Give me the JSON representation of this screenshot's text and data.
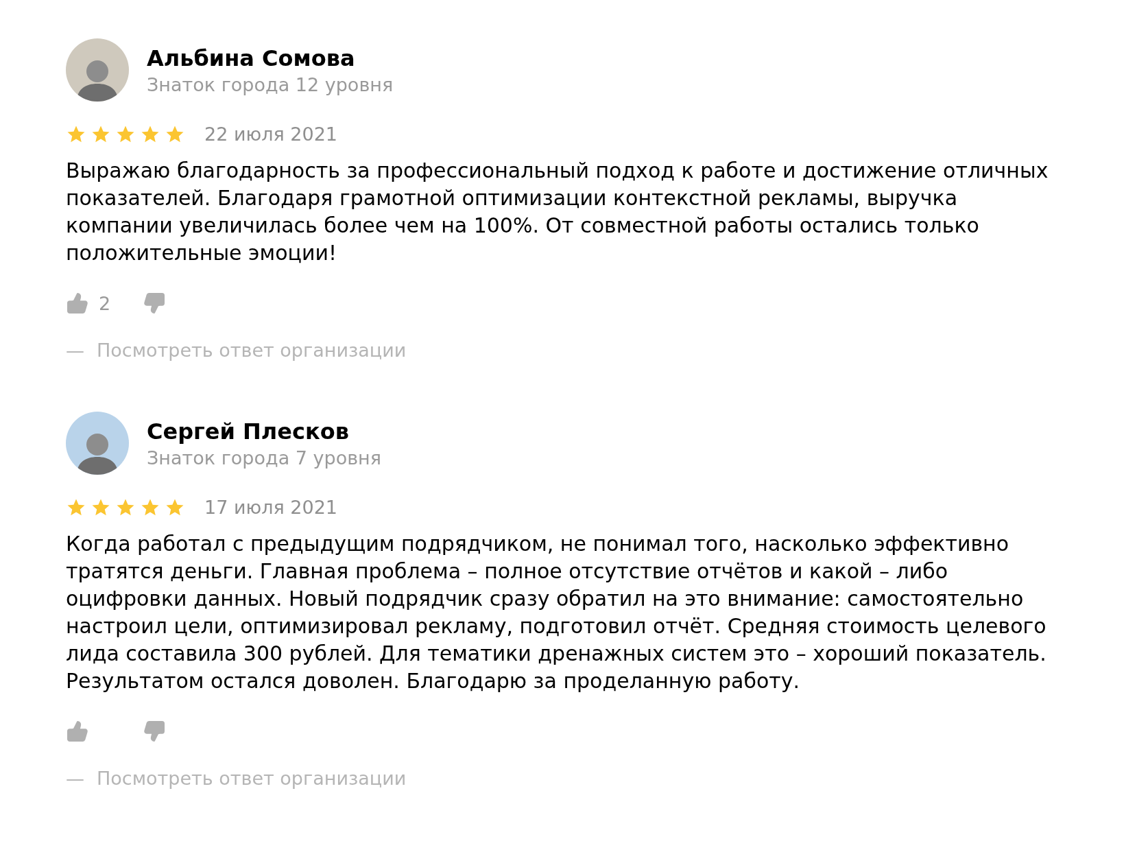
{
  "reviews": [
    {
      "name": "Альбина Сомова",
      "level": "Знаток города 12 уровня",
      "stars": 5,
      "date": "22 июля 2021",
      "text": "Выражаю благодарность за профессиональный подход к работе и достижение отличных показателей. Благодаря грамотной оптимизации контекстной рекламы, выручка компании увеличилась более чем на 100%. От совместной работы остались только положительные эмоции!",
      "likes": "2",
      "dash": "—",
      "reply_link": "Посмотреть ответ организации"
    },
    {
      "name": "Сергей Плесков",
      "level": "Знаток города 7 уровня",
      "stars": 5,
      "date": "17 июля 2021",
      "text": "Когда работал с предыдущим подрядчиком, не понимал того, насколько эффективно тратятся деньги. Главная проблема – полное отсутствие отчётов и какой – либо оцифровки данных. Новый подрядчик сразу обратил на это внимание: самостоятельно настроил цели, оптимизировал рекламу, подготовил отчёт. Средняя стоимость целевого лида составила 300 рублей. Для тематики дренажных систем это – хороший показатель. Результатом остался доволен. Благодарю за проделанную работу.",
      "dash": "—",
      "reply_link": "Посмотреть ответ организации"
    }
  ]
}
